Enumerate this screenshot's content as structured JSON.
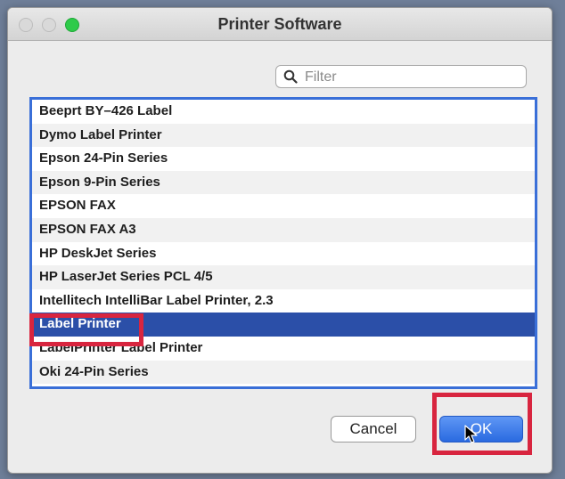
{
  "window": {
    "title": "Printer Software"
  },
  "filter": {
    "placeholder": "Filter",
    "value": "",
    "icon": "search-icon"
  },
  "printers": {
    "items": [
      "Beeprt BY–426 Label",
      "Dymo Label Printer",
      "Epson 24-Pin Series",
      "Epson 9-Pin Series",
      "EPSON FAX",
      "EPSON FAX A3",
      "HP DeskJet Series",
      "HP LaserJet Series PCL 4/5",
      "Intellitech IntelliBar Label Printer, 2.3",
      "Label Printer",
      "LabelPrinter Label Printer",
      "Oki 24-Pin Series"
    ],
    "selected": "Label Printer"
  },
  "buttons": {
    "cancel": "Cancel",
    "ok": "OK"
  },
  "colors": {
    "selection": "#2b4fa8",
    "accent": "#3a6fd8",
    "highlight": "#d8253f",
    "zoom": "#2ecb4a"
  }
}
